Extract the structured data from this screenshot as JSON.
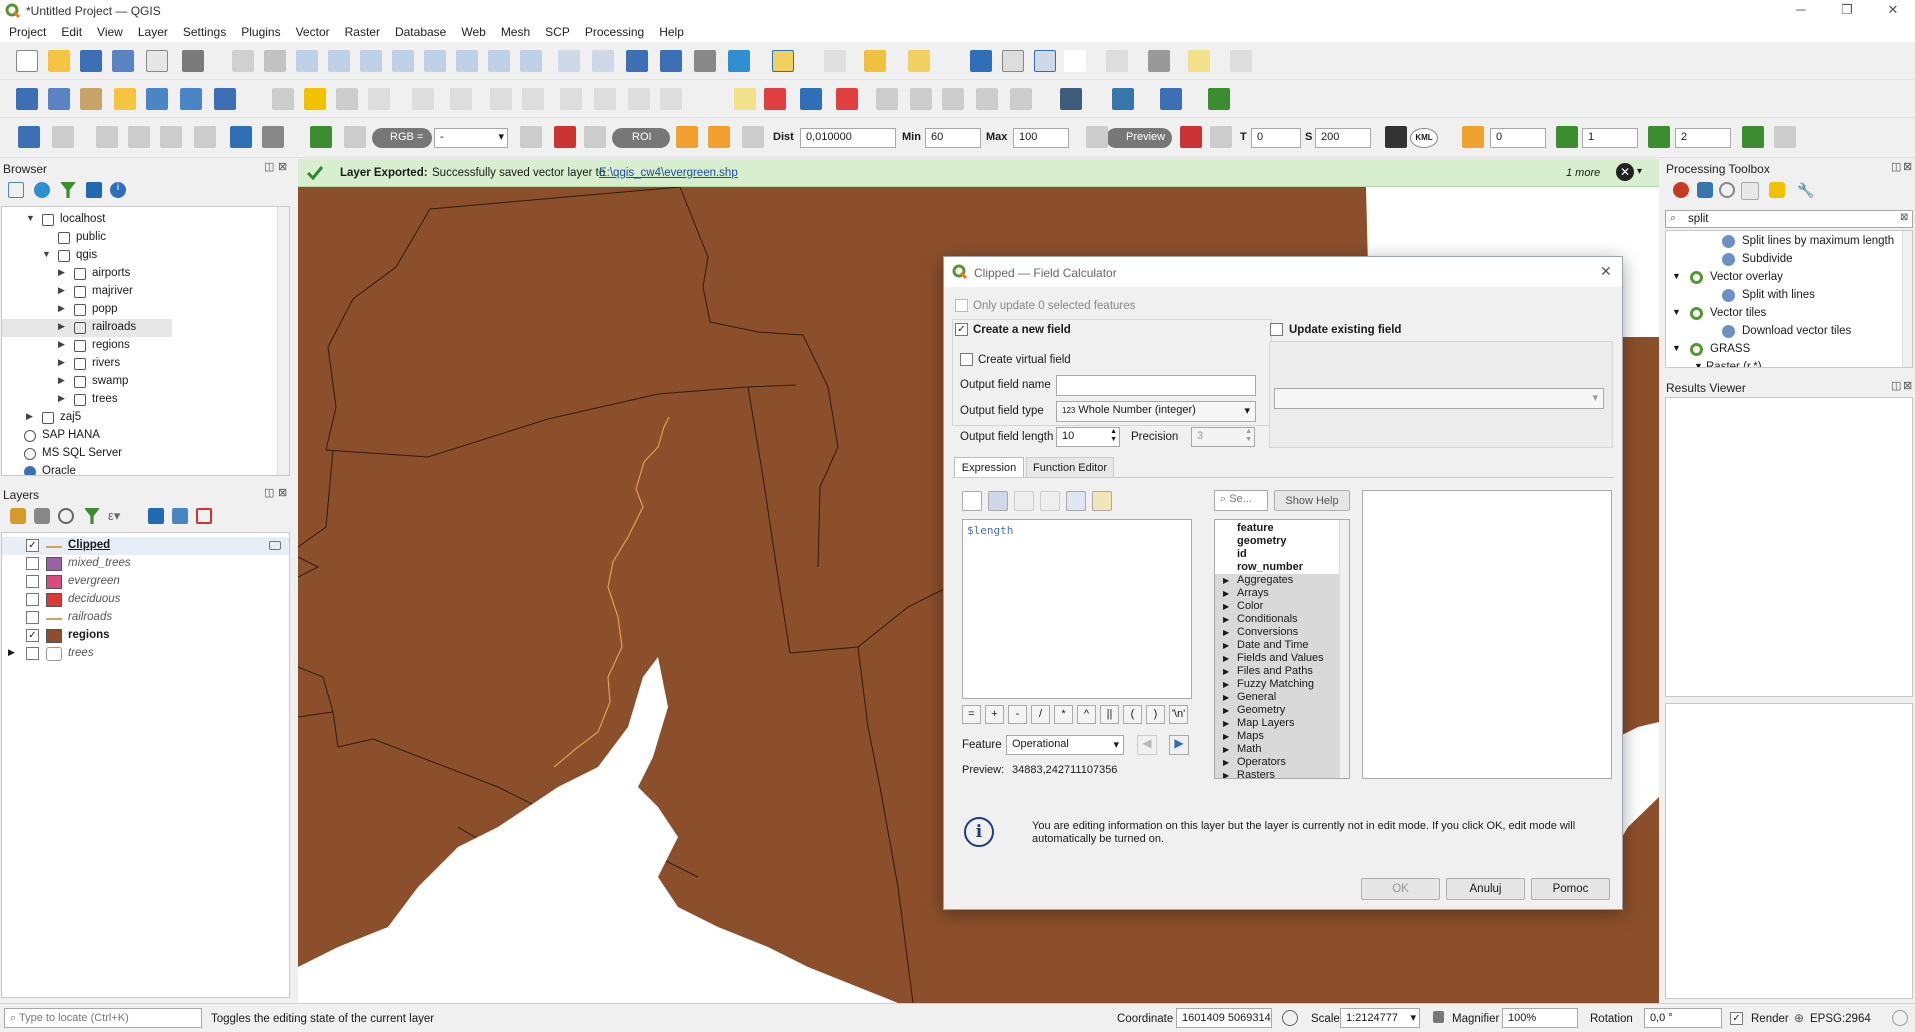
{
  "window": {
    "title": "*Untitled Project — QGIS"
  },
  "menu": [
    "Project",
    "Edit",
    "View",
    "Layer",
    "Settings",
    "Plugins",
    "Vector",
    "Raster",
    "Database",
    "Web",
    "Mesh",
    "SCP",
    "Processing",
    "Help"
  ],
  "scp": {
    "rgb_label": "RGB =",
    "rgb_value": "-",
    "roi_label": "ROI",
    "dist_label": "Dist",
    "dist_value": "0,010000",
    "min_label": "Min",
    "min_value": "60",
    "max_label": "Max",
    "max_value": "100",
    "preview_label": "Preview",
    "t_label": "T",
    "t_value": "0",
    "s_label": "S",
    "s_value": "200",
    "kml_label": "KML",
    "n1": "0",
    "n2": "1",
    "n3": "2"
  },
  "browser": {
    "title": "Browser",
    "items": [
      {
        "label": "localhost",
        "level": 1,
        "expanded": true
      },
      {
        "label": "public",
        "level": 2
      },
      {
        "label": "qgis",
        "level": 2,
        "expanded": true
      },
      {
        "label": "airports",
        "level": 3
      },
      {
        "label": "majriver",
        "level": 3
      },
      {
        "label": "popp",
        "level": 3
      },
      {
        "label": "railroads",
        "level": 3,
        "selected": true
      },
      {
        "label": "regions",
        "level": 3
      },
      {
        "label": "rivers",
        "level": 3
      },
      {
        "label": "swamp",
        "level": 3
      },
      {
        "label": "trees",
        "level": 3
      },
      {
        "label": "zaj5",
        "level": 1
      },
      {
        "label": "SAP HANA",
        "level": 0
      },
      {
        "label": "MS SQL Server",
        "level": 0
      },
      {
        "label": "Oracle",
        "level": 0
      }
    ]
  },
  "layers": {
    "title": "Layers",
    "items": [
      {
        "label": "Clipped",
        "checked": true,
        "style": "bold-underline",
        "color": "#d9a253",
        "kind": "line"
      },
      {
        "label": "mixed_trees",
        "checked": false,
        "style": "italic",
        "color": "#9a63a8",
        "kind": "fill"
      },
      {
        "label": "evergreen",
        "checked": false,
        "style": "italic",
        "color": "#d94b7a",
        "kind": "fill"
      },
      {
        "label": "deciduous",
        "checked": false,
        "style": "italic",
        "color": "#d93a3a",
        "kind": "fill"
      },
      {
        "label": "railroads",
        "checked": false,
        "style": "italic",
        "color": "#c8a36a",
        "kind": "line"
      },
      {
        "label": "regions",
        "checked": true,
        "style": "bold",
        "color": "#8c4f2b",
        "kind": "fill"
      },
      {
        "label": "trees",
        "checked": false,
        "style": "italic",
        "color": "#999999",
        "kind": "group"
      }
    ]
  },
  "message": {
    "bold": "Layer Exported:",
    "text": "Successfully saved vector layer to",
    "link": "E:\\qgis_cw4\\evergreen.shp",
    "more": "1 more"
  },
  "processing": {
    "title": "Processing Toolbox",
    "search": "split",
    "items": [
      {
        "label": "Split lines by maximum length",
        "level": 2
      },
      {
        "label": "Subdivide",
        "level": 2
      },
      {
        "label": "Vector overlay",
        "level": 1
      },
      {
        "label": "Split with lines",
        "level": 2
      },
      {
        "label": "Vector tiles",
        "level": 1
      },
      {
        "label": "Download vector tiles",
        "level": 2
      },
      {
        "label": "GRASS",
        "level": 1
      },
      {
        "label": "Raster (r.*)",
        "level": 2
      }
    ]
  },
  "results": {
    "title": "Results Viewer"
  },
  "dialog": {
    "title": "Clipped — Field Calculator",
    "only_update": "Only update 0 selected features",
    "create_new": "Create a new field",
    "update_existing": "Update existing field",
    "create_virtual": "Create virtual field",
    "out_name_label": "Output field name",
    "out_name_value": "",
    "out_type_label": "Output field type",
    "out_type_value": "Whole Number (integer)",
    "out_type_icon": "123",
    "out_len_label": "Output field length",
    "out_len_value": "10",
    "precision_label": "Precision",
    "precision_value": "3",
    "tab_expression": "Expression",
    "tab_function": "Function Editor",
    "expression": "$length",
    "search_placeholder": "Se...",
    "show_help": "Show Help",
    "operators": [
      "=",
      "+",
      "-",
      "/",
      "*",
      "^",
      "||",
      "(",
      ")",
      "'\\n'"
    ],
    "feature_label": "Feature",
    "feature_value": "Operational",
    "preview_label": "Preview:",
    "preview_value": "34883,242711107356",
    "functions": [
      {
        "label": "feature",
        "bold": true
      },
      {
        "label": "geometry",
        "bold": true
      },
      {
        "label": "id",
        "bold": true
      },
      {
        "label": "row_number",
        "bold": true
      },
      {
        "label": "Aggregates",
        "group": true
      },
      {
        "label": "Arrays",
        "group": true
      },
      {
        "label": "Color",
        "group": true
      },
      {
        "label": "Conditionals",
        "group": true
      },
      {
        "label": "Conversions",
        "group": true
      },
      {
        "label": "Date and Time",
        "group": true
      },
      {
        "label": "Fields and Values",
        "group": true
      },
      {
        "label": "Files and Paths",
        "group": true
      },
      {
        "label": "Fuzzy Matching",
        "group": true
      },
      {
        "label": "General",
        "group": true
      },
      {
        "label": "Geometry",
        "group": true
      },
      {
        "label": "Map Layers",
        "group": true
      },
      {
        "label": "Maps",
        "group": true
      },
      {
        "label": "Math",
        "group": true
      },
      {
        "label": "Operators",
        "group": true
      },
      {
        "label": "Rasters",
        "group": true
      }
    ],
    "info": "You are editing information on this layer but the layer is currently not in edit mode. If you click OK, edit mode will automatically be turned on.",
    "ok": "OK",
    "cancel": "Anuluj",
    "help": "Pomoc"
  },
  "status": {
    "locate_placeholder": "Type to locate (Ctrl+K)",
    "hint": "Toggles the editing state of the current layer",
    "coord_label": "Coordinate",
    "coord_value": "1601409  5069314",
    "scale_label": "Scale",
    "scale_value": "1:2124777",
    "magnifier_label": "Magnifier",
    "magnifier_value": "100%",
    "rotation_label": "Rotation",
    "rotation_value": "0,0 °",
    "render_label": "Render",
    "crs": "EPSG:2964"
  },
  "colors": {
    "map_fill": "#8c4f2b",
    "river": "#e0a050",
    "msg_bg": "#d7efcf",
    "accent": "#2f6fb7"
  }
}
